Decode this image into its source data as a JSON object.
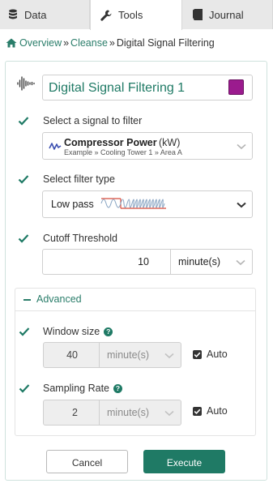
{
  "tabs": [
    {
      "label": "Data",
      "icon": "database-icon"
    },
    {
      "label": "Tools",
      "icon": "wrench-icon",
      "active": true
    },
    {
      "label": "Journal",
      "icon": "book-icon"
    }
  ],
  "breadcrumb": {
    "home_icon": "home-icon",
    "overview": "Overview",
    "sep1": "»",
    "cleanse": "Cleanse",
    "sep2": "»",
    "current": "Digital Signal Filtering"
  },
  "form": {
    "name_value": "Digital Signal Filtering  1",
    "color": "#9b1b8e",
    "signal": {
      "label": "Select a signal to filter",
      "name": "Compressor Power",
      "unit": "(kW)",
      "path": "Example » Cooling Tower 1 » Area A"
    },
    "filter_type": {
      "label": "Select filter type",
      "value": "Low pass"
    },
    "cutoff": {
      "label": "Cutoff Threshold",
      "value": "10",
      "unit": "minute(s)"
    }
  },
  "advanced": {
    "title": "Advanced",
    "window_size": {
      "label": "Window size",
      "value": "40",
      "unit": "minute(s)",
      "auto_label": "Auto",
      "auto_checked": true
    },
    "sampling_rate": {
      "label": "Sampling Rate",
      "value": "2",
      "unit": "minute(s)",
      "auto_label": "Auto",
      "auto_checked": true
    }
  },
  "actions": {
    "cancel": "Cancel",
    "execute": "Execute"
  },
  "colors": {
    "accent": "#1f7a65",
    "link": "#2a7d6a"
  }
}
